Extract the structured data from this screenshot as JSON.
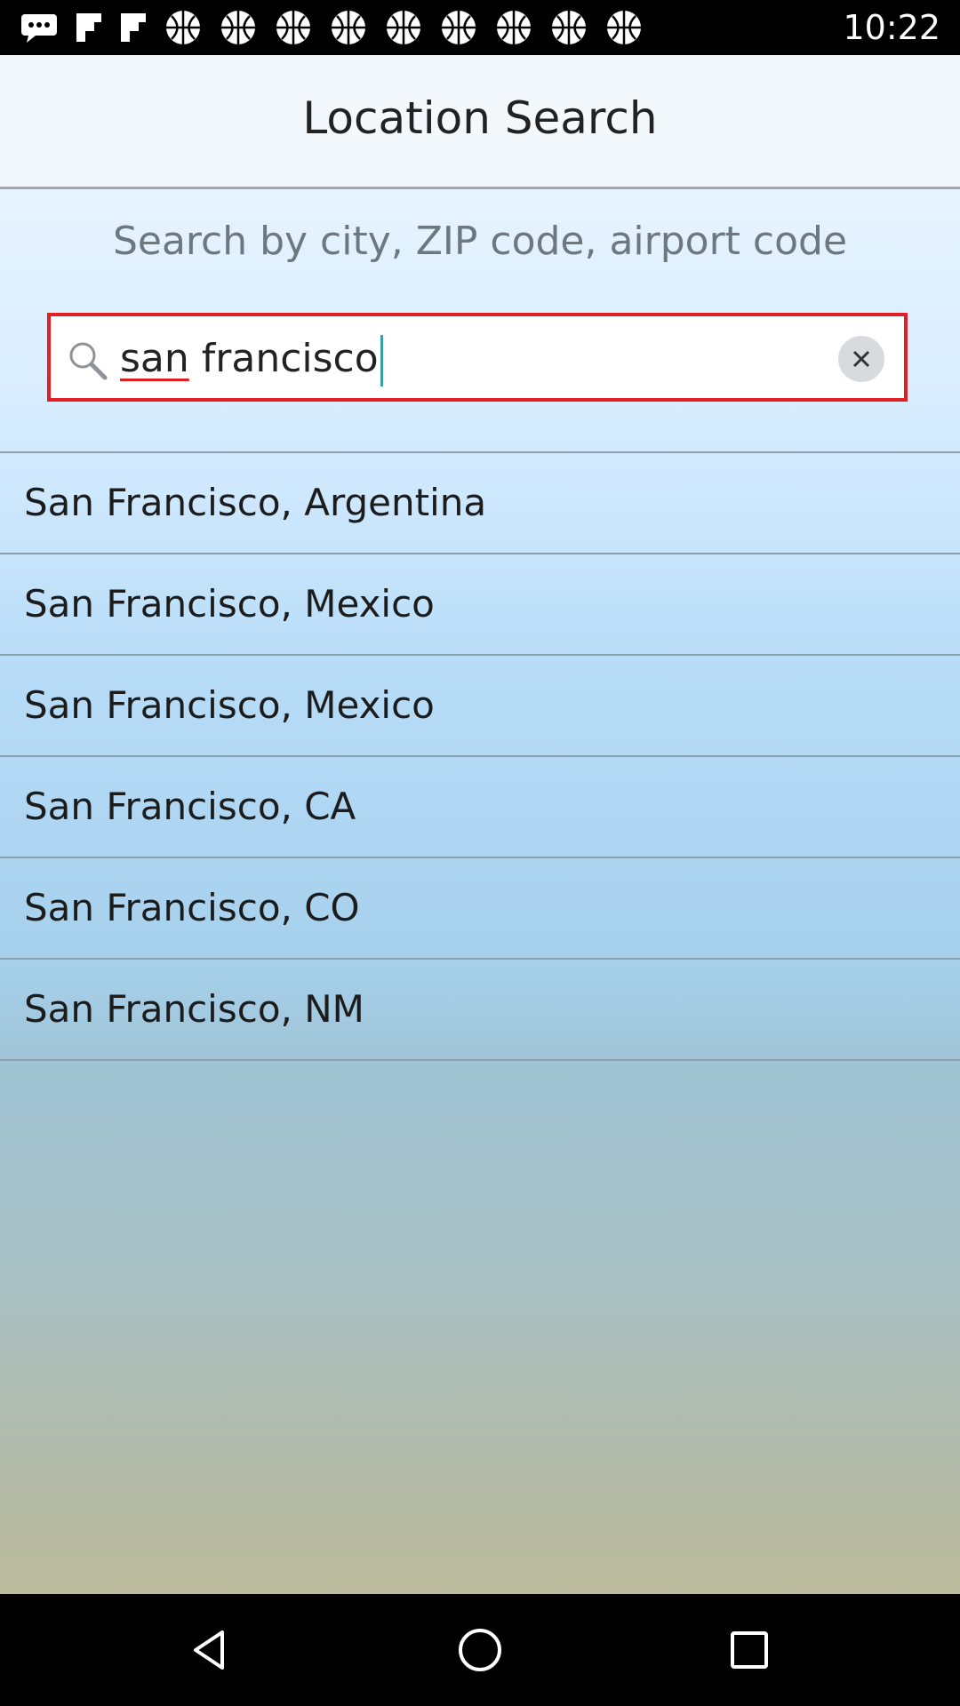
{
  "status_bar": {
    "time": "10:22",
    "icons": [
      "messages-icon",
      "flipboard-icon",
      "flipboard-icon",
      "basketball-icon",
      "basketball-icon",
      "basketball-icon",
      "basketball-icon",
      "basketball-icon",
      "basketball-icon",
      "basketball-icon",
      "basketball-icon"
    ]
  },
  "header": {
    "title": "Location Search"
  },
  "search": {
    "hint": "Search by city, ZIP code, airport code",
    "value_word1": "san",
    "value_word2": "francisco",
    "highlight_color": "#e01f25"
  },
  "results": [
    {
      "label": "San Francisco, Argentina"
    },
    {
      "label": "San Francisco, Mexico"
    },
    {
      "label": "San Francisco, Mexico"
    },
    {
      "label": "San Francisco, CA"
    },
    {
      "label": "San Francisco, CO"
    },
    {
      "label": "San Francisco, NM"
    }
  ],
  "nav_bar": {
    "buttons": [
      "back-icon",
      "home-icon",
      "recents-icon"
    ]
  }
}
